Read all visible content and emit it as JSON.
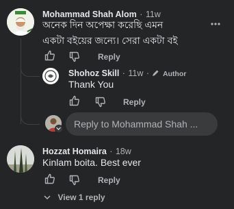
{
  "comments": [
    {
      "name": "Mohammad Shah Alom",
      "time": "11w",
      "text_lines": [
        "অনেক দিন অপেক্ষা করেছি এমন",
        "একটা বইয়ের জন্যে। সেরা একটা বই"
      ],
      "reply_label": "Reply",
      "more_icon": "more-dots-icon"
    },
    {
      "name": "Shohoz Skill",
      "time": "11w",
      "badge": "Author",
      "text": "Thank You",
      "reply_label": "Reply"
    },
    {
      "name": "Hozzat Homaira",
      "time": "18w",
      "text": "Kinlam boita. Best ever",
      "reply_label": "Reply",
      "view_replies": "View 1 reply"
    }
  ],
  "reply_input": {
    "placeholder": "Reply to Mohammad Shah ..."
  },
  "separator": "·",
  "icons": [
    "like-icon",
    "dislike-icon",
    "pencil-icon",
    "chevron-down-icon",
    "more-dots-icon"
  ],
  "colors": {
    "background": "#242526",
    "text": "#e4e6eb",
    "secondary": "#b0b3b8",
    "input_bg": "#3a3b3c"
  }
}
